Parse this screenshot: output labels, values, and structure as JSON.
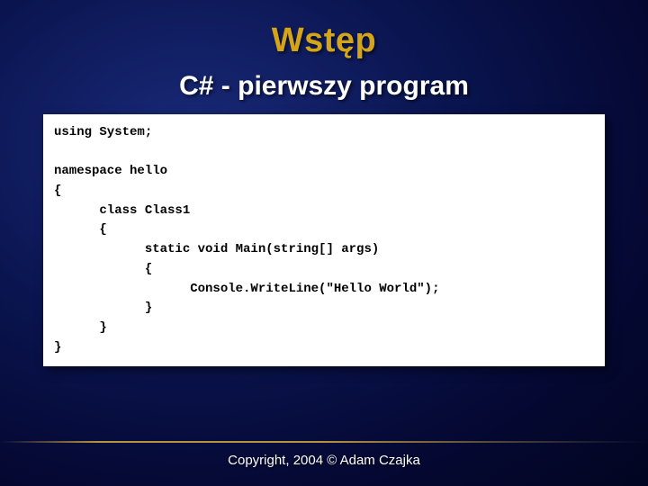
{
  "slide": {
    "title": "Wstęp",
    "subtitle": "C# - pierwszy program",
    "code": "using System;\n\nnamespace hello\n{\n      class Class1\n      {\n            static void Main(string[] args)\n            {\n                  Console.WriteLine(\"Hello World\");\n            }\n      }\n}",
    "footer": "Copyright, 2004 © Adam Czajka"
  }
}
